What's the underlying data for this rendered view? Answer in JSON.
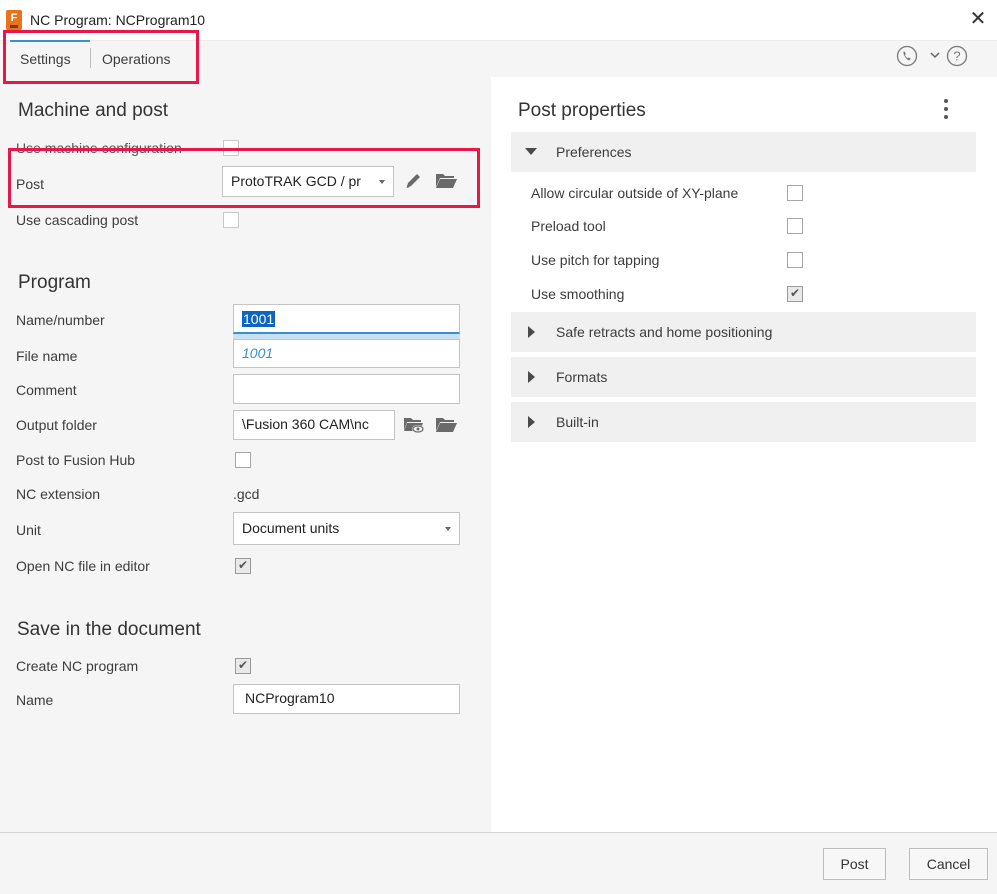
{
  "window": {
    "title": "NC Program: NCProgram10",
    "icon_letter": "F"
  },
  "tabs": [
    {
      "label": "Settings",
      "active": true
    },
    {
      "label": "Operations",
      "active": false
    }
  ],
  "header_icons": [
    "phone-icon",
    "chevron-down-icon",
    "help-icon"
  ],
  "machine_post": {
    "title": "Machine and post",
    "use_machine_config_label": "Use machine configuration",
    "use_machine_config_checked": false,
    "post_label": "Post",
    "post_value": "ProtoTRAK GCD / pr",
    "use_cascading_label": "Use cascading post",
    "use_cascading_checked": false
  },
  "program": {
    "title": "Program",
    "name_label": "Name/number",
    "name_value": "1001",
    "filename_label": "File name",
    "filename_value": "1001",
    "comment_label": "Comment",
    "comment_value": "",
    "output_folder_label": "Output folder",
    "output_folder_value": "\\Fusion 360 CAM\\nc",
    "post_hub_label": "Post to Fusion Hub",
    "post_hub_checked": false,
    "nc_ext_label": "NC extension",
    "nc_ext_value": ".gcd",
    "unit_label": "Unit",
    "unit_value": "Document units",
    "open_editor_label": "Open NC file in editor",
    "open_editor_checked": true
  },
  "save_doc": {
    "title": "Save in the document",
    "create_label": "Create NC program",
    "create_checked": true,
    "name_label": "Name",
    "name_value": "NCProgram10"
  },
  "post_properties": {
    "title": "Post properties",
    "groups": [
      {
        "label": "Preferences",
        "expanded": true
      },
      {
        "label": "Safe retracts and home positioning",
        "expanded": false
      },
      {
        "label": "Formats",
        "expanded": false
      },
      {
        "label": "Built-in",
        "expanded": false
      }
    ],
    "preferences": [
      {
        "label": "Allow circular outside of XY-plane",
        "checked": false
      },
      {
        "label": "Preload tool",
        "checked": false
      },
      {
        "label": "Use pitch for tapping",
        "checked": false
      },
      {
        "label": "Use smoothing",
        "checked": true
      }
    ]
  },
  "footer": {
    "post_label": "Post",
    "cancel_label": "Cancel"
  },
  "colors": {
    "accent": "#3b8fd1",
    "highlight": "#e5174b",
    "selection": "#0a66c2"
  }
}
